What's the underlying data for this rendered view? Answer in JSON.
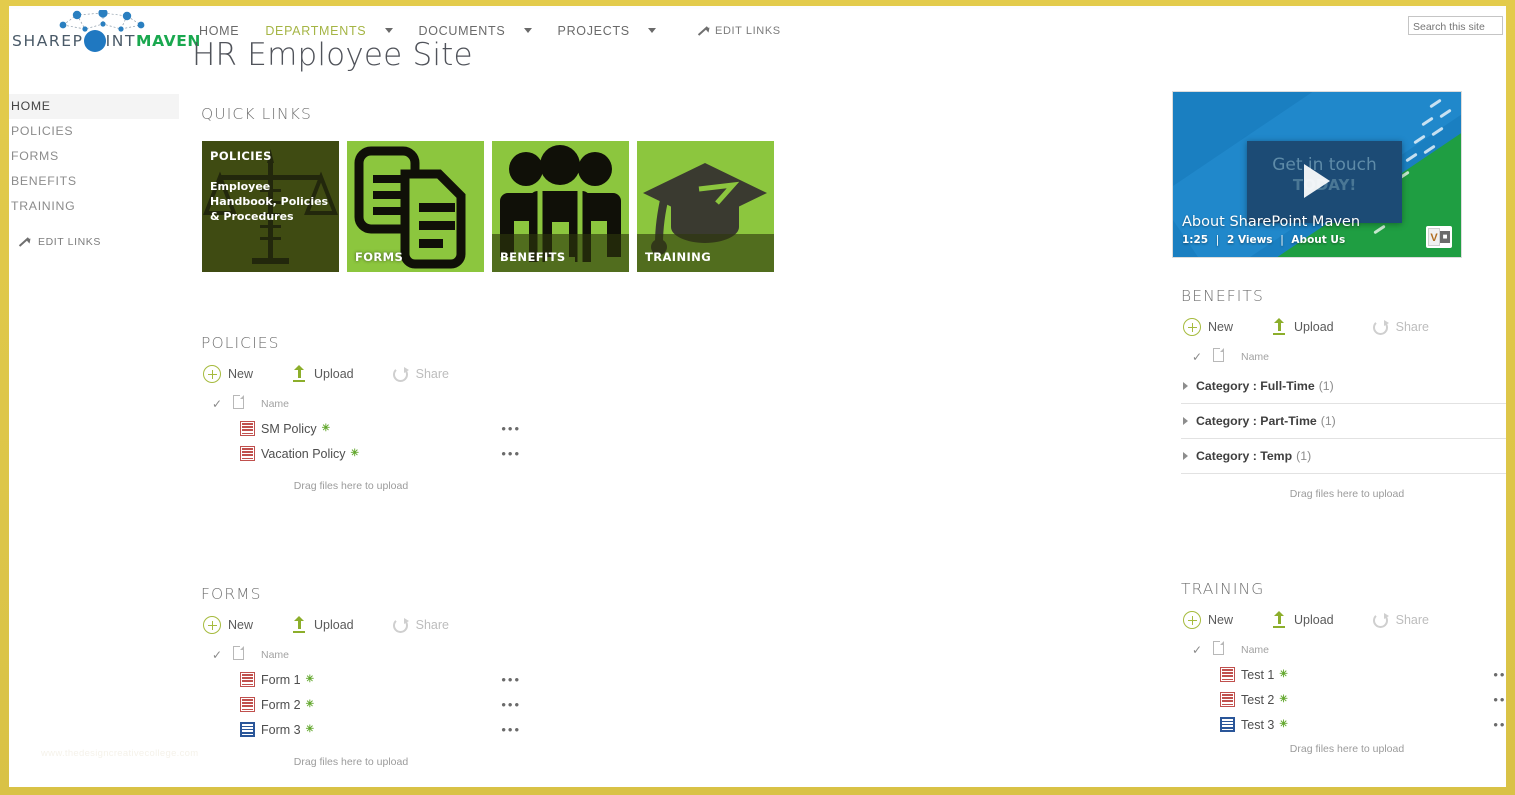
{
  "brand": {
    "logo_part1": "SHAREP",
    "logo_dot_icon": "blue-circle-o",
    "logo_part2": "INT",
    "logo_part3": "MAVEN"
  },
  "colors": {
    "frame_gold": "#d9c246",
    "brand_green": "#1aa84f",
    "accent_olive": "#a5b545",
    "tile_green": "#8cc63e",
    "tile_dark_olive": "#5b6b1e",
    "new_icon_green": "#a6bb3e",
    "upload_green": "#8cae2b",
    "disabled_gray": "#bdbdbd",
    "video_blue": "#1a7fc1",
    "video_green": "#1f9e42"
  },
  "topnav": {
    "items": [
      {
        "label": "HOME",
        "selected": false,
        "has_dropdown": false
      },
      {
        "label": "DEPARTMENTS",
        "selected": true,
        "has_dropdown": true
      },
      {
        "label": "DOCUMENTS",
        "selected": false,
        "has_dropdown": true
      },
      {
        "label": "PROJECTS",
        "selected": false,
        "has_dropdown": true
      }
    ],
    "edit_links_label": "EDIT LINKS",
    "edit_links_icon": "pencil-icon"
  },
  "search": {
    "placeholder": "Search this site",
    "value": ""
  },
  "header": {
    "title": "HR Employee Site"
  },
  "sidebar": {
    "items": [
      {
        "label": "HOME",
        "selected": true
      },
      {
        "label": "POLICIES",
        "selected": false
      },
      {
        "label": "FORMS",
        "selected": false
      },
      {
        "label": "BENEFITS",
        "selected": false
      },
      {
        "label": "TRAINING",
        "selected": false
      }
    ],
    "edit_links_label": "EDIT LINKS",
    "edit_links_icon": "pencil-icon"
  },
  "quick_links": {
    "title": "QUICK LINKS",
    "tiles": [
      {
        "label": "POLICIES",
        "description": "Employee Handbook, Policies & Procedures",
        "icon": "scales-of-justice-icon",
        "state": "hover"
      },
      {
        "label": "FORMS",
        "description": "",
        "icon": "documents-icon",
        "state": "normal"
      },
      {
        "label": "BENEFITS",
        "description": "",
        "icon": "people-group-icon",
        "state": "normal"
      },
      {
        "label": "TRAINING",
        "description": "",
        "icon": "graduation-cap-icon",
        "state": "normal"
      }
    ]
  },
  "commands": {
    "new_label": "New",
    "new_icon": "plus-circle-icon",
    "upload_label": "Upload",
    "upload_icon": "upload-arrow-icon",
    "share_label": "Share",
    "share_icon": "share-circle-icon",
    "share_disabled": true
  },
  "list_common": {
    "column_name": "Name",
    "check_icon": "checkmark-icon",
    "doc_type_icon": "document-sheet-icon",
    "drag_text": "Drag files here to upload",
    "ellipsis": "•••",
    "new_badge": "✳"
  },
  "libraries": [
    {
      "id": "policies",
      "title": "POLICIES",
      "files": [
        {
          "name": "SM Policy",
          "type": "powerpoint",
          "is_new": true
        },
        {
          "name": "Vacation Policy",
          "type": "powerpoint",
          "is_new": true
        }
      ]
    },
    {
      "id": "forms",
      "title": "FORMS",
      "files": [
        {
          "name": "Form 1",
          "type": "powerpoint",
          "is_new": true
        },
        {
          "name": "Form 2",
          "type": "powerpoint",
          "is_new": true
        },
        {
          "name": "Form 3",
          "type": "word",
          "is_new": true
        }
      ]
    },
    {
      "id": "benefits",
      "title": "BENEFITS",
      "groups": [
        {
          "field": "Category",
          "value": "Full-Time",
          "count": "(1)"
        },
        {
          "field": "Category",
          "value": "Part-Time",
          "count": "(1)"
        },
        {
          "field": "Category",
          "value": "Temp",
          "count": "(1)"
        }
      ]
    },
    {
      "id": "training",
      "title": "TRAINING",
      "files": [
        {
          "name": "Test 1",
          "type": "powerpoint",
          "is_new": true
        },
        {
          "name": "Test 2",
          "type": "powerpoint",
          "is_new": true
        },
        {
          "name": "Test 3",
          "type": "word",
          "is_new": true
        }
      ]
    }
  ],
  "video": {
    "overlay_line1": "Get in touch",
    "overlay_line2": "TODAY!",
    "title": "About SharePoint Maven",
    "duration": "1:25",
    "views": "2 Views",
    "source": "About Us",
    "play_icon": "play-triangle-icon",
    "badge_icon": "office-video-badge-icon",
    "badge_letter": "V",
    "badge_mark": "■"
  },
  "watermark": {
    "text": "www.thedesigncreativecollege.com"
  }
}
